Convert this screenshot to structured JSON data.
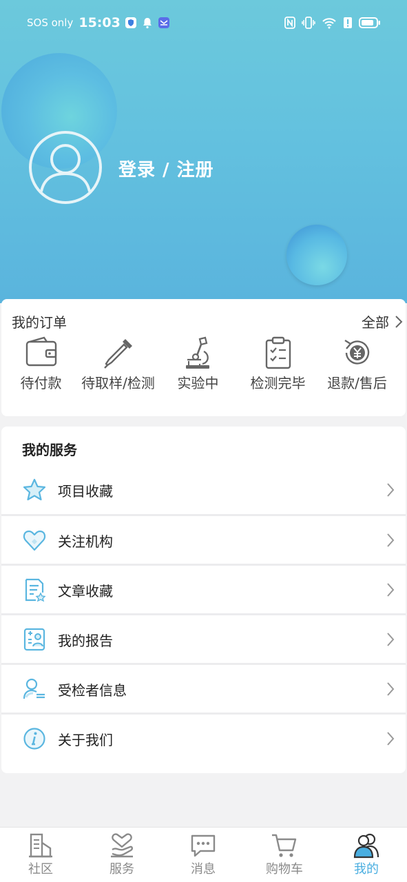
{
  "status_bar": {
    "carrier": "SOS only",
    "time": "15:03"
  },
  "profile": {
    "login_label": "登录 / 注册"
  },
  "orders": {
    "title": "我的订单",
    "all_label": "全部",
    "items": [
      {
        "label": "待付款",
        "icon": "wallet-icon"
      },
      {
        "label": "待取样/检测",
        "icon": "dropper-icon"
      },
      {
        "label": "实验中",
        "icon": "microscope-icon"
      },
      {
        "label": "检测完毕",
        "icon": "clipboard-check-icon"
      },
      {
        "label": "退款/售后",
        "icon": "refund-icon"
      }
    ]
  },
  "services": {
    "title": "我的服务",
    "items": [
      {
        "label": "项目收藏",
        "icon": "star-icon"
      },
      {
        "label": "关注机构",
        "icon": "heart-icon"
      },
      {
        "label": "文章收藏",
        "icon": "article-icon"
      },
      {
        "label": "我的报告",
        "icon": "report-icon"
      },
      {
        "label": "受检者信息",
        "icon": "person-info-icon"
      },
      {
        "label": "关于我们",
        "icon": "info-icon"
      }
    ]
  },
  "tabs": [
    {
      "label": "社区",
      "icon": "community-icon"
    },
    {
      "label": "服务",
      "icon": "service-icon"
    },
    {
      "label": "消息",
      "icon": "message-icon"
    },
    {
      "label": "购物车",
      "icon": "cart-icon"
    },
    {
      "label": "我的",
      "icon": "mine-icon",
      "active": true
    }
  ],
  "colors": {
    "header_gradient_top": "#6cc9dc",
    "header_gradient_bottom": "#5ab4dd",
    "accent": "#4aaee0",
    "icon_blue": "#5ab6e0"
  }
}
